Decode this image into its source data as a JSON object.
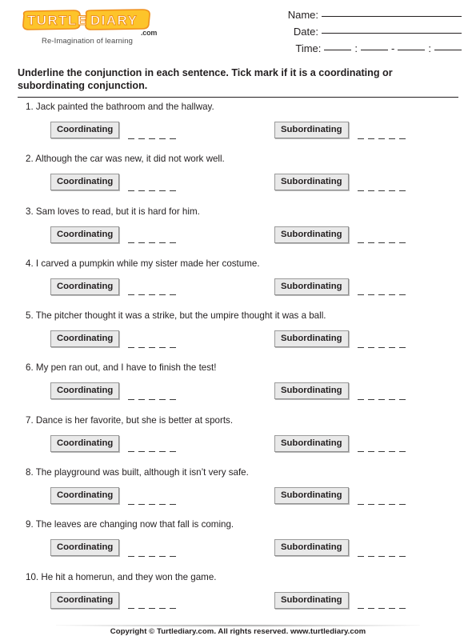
{
  "header": {
    "logo": {
      "wordmark_line1": "TURTLE",
      "wordmark_line2": "DIARY",
      "dotcom": ".com",
      "tagline": "Re-Imagination of learning",
      "brand_color": "#fdc42a",
      "brand_outline": "#f08a1c"
    },
    "fields": [
      {
        "label": "Name:",
        "type": "long"
      },
      {
        "label": "Date:",
        "type": "long"
      },
      {
        "label": "Time:",
        "type": "time",
        "separators": [
          ":",
          "-",
          ":"
        ]
      }
    ]
  },
  "instruction": "Underline the conjunction in each sentence. Tick mark if it is a coordinating or subordinating conjunction.",
  "options": {
    "coordinating_label": "Coordinating",
    "subordinating_label": "Subordinating",
    "dash_count": 5
  },
  "questions": [
    {
      "number": "1.",
      "text": "Jack painted the bathroom and the hallway."
    },
    {
      "number": "2.",
      "text": "Although the car was new, it did not work well."
    },
    {
      "number": "3.",
      "text": "Sam loves to read, but it is hard for him."
    },
    {
      "number": "4.",
      "text": "I carved a pumpkin while my sister made her costume."
    },
    {
      "number": "5.",
      "text": "The pitcher thought it was a strike, but the umpire thought it was a ball."
    },
    {
      "number": "6.",
      "text": "My pen ran out, and I have to finish the test!"
    },
    {
      "number": "7.",
      "text": "Dance is her favorite, but she is better at sports."
    },
    {
      "number": "8.",
      "text": "The playground was built, although it isn’t very safe."
    },
    {
      "number": "9.",
      "text": "The leaves are changing now that fall is coming."
    },
    {
      "number": "10.",
      "text": "He hit a homerun, and they won the game."
    }
  ],
  "footer": {
    "copyright": "Copyright © Turtlediary.com. All rights reserved. www.turtlediary.com"
  }
}
